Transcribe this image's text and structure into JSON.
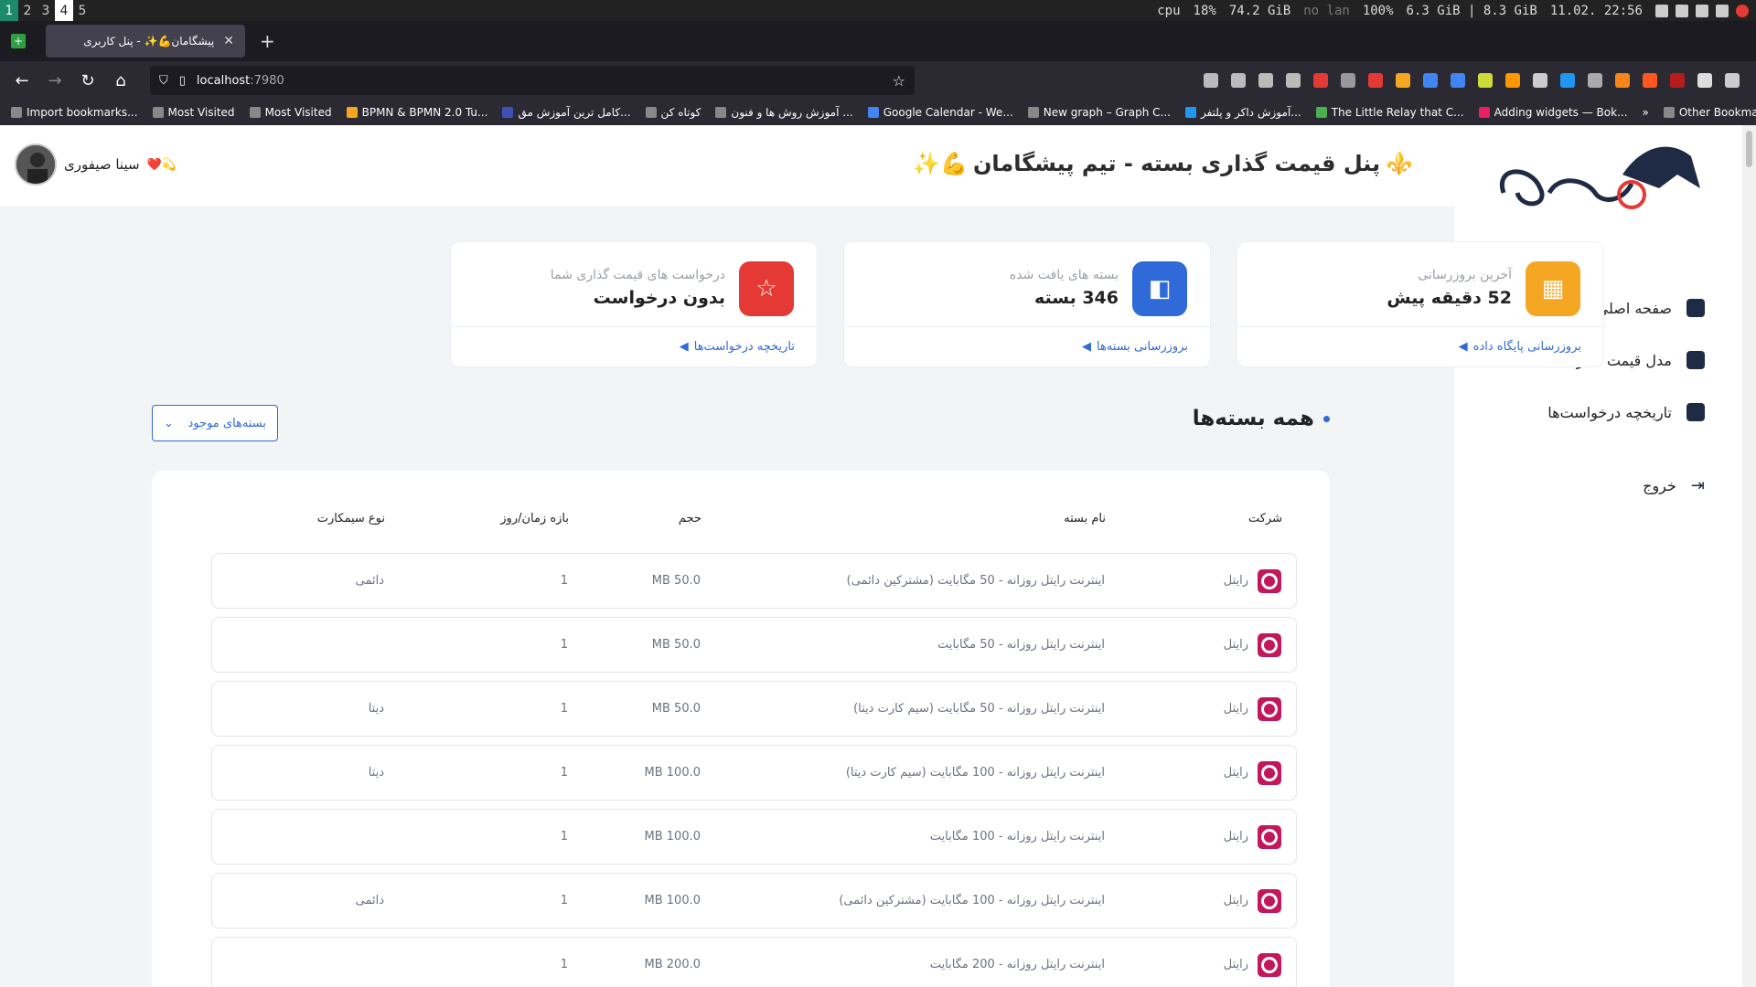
{
  "system": {
    "workspaces": [
      "1",
      "2",
      "3",
      "4",
      "5"
    ],
    "cpu_label": "cpu",
    "cpu_value": "18%",
    "disk": "74.2 GiB",
    "lan": "no lan",
    "battery": "100%",
    "memory": "6.3 GiB | 8.3 GiB",
    "datetime": "11.02. 22:56"
  },
  "browser": {
    "tab_title": "پیشگامان💪✨ - پنل کاربری",
    "url_host": "localhost",
    "url_port": ":7980",
    "bookmarks": [
      "Import bookmarks...",
      "Most Visited",
      "Most Visited",
      "BPMN & BPMN 2.0 Tu...",
      "کامل ترین آموزش مق...",
      "کوتاه کن",
      "آموزش روش ها و فنون ...",
      "Google Calendar - We...",
      "New graph – Graph C...",
      "آموزش داکر و پلتفر...",
      "The Little Relay that C...",
      "Adding widgets — Bok..."
    ],
    "other_bookmarks": "Other Bookmarks"
  },
  "header": {
    "title": "پنل قیمت گذاری بسته - تیم پیشگامان",
    "title_prefix_emoji": "⚜️",
    "title_suffix_emoji": "💪✨",
    "user_name": "سینا صیفوری",
    "user_emoji": "❤️💫"
  },
  "sidebar": {
    "items": [
      {
        "label": "صفحه اصلی پنل"
      },
      {
        "label": "مدل قیمت گذاری"
      },
      {
        "label": "تاریخچه درخواست‌ها"
      }
    ],
    "logout": "خروج"
  },
  "cards": [
    {
      "label": "آخرین بروزرسانی",
      "value": "52 دقیقه پیش",
      "link": "بروزرسانی پایگاه داده",
      "color": "#f5a623"
    },
    {
      "label": "بسته های یافت شده",
      "value": "346 بسته",
      "link": "بروزرسانی بسته‌ها",
      "color": "#2f6ad8"
    },
    {
      "label": "درخواست های قیمت گذاری شما",
      "value": "بدون درخواست",
      "link": "تاریخچه درخواست‌ها",
      "color": "#e53935"
    }
  ],
  "packages": {
    "title": "همه بسته‌ها",
    "filter": "بسته‌های موجود",
    "columns": [
      "شرکت",
      "نام بسته",
      "حجم",
      "بازه زمان/روز",
      "نوع سیمکارت"
    ],
    "rows": [
      {
        "company": "رایتل",
        "name": "اینترنت رایتل روزانه - 50 مگابایت (مشترکین دائمی)",
        "volume": "50.0 MB",
        "days": "1",
        "sim": "دائمی"
      },
      {
        "company": "رایتل",
        "name": "اینترنت رایتل روزانه - 50 مگابایت",
        "volume": "50.0 MB",
        "days": "1",
        "sim": ""
      },
      {
        "company": "رایتل",
        "name": "اینترنت رایتل روزانه - 50 مگابایت (سیم کارت دیتا)",
        "volume": "50.0 MB",
        "days": "1",
        "sim": "دیتا"
      },
      {
        "company": "رایتل",
        "name": "اینترنت رایتل روزانه - 100 مگابایت (سیم کارت دیتا)",
        "volume": "100.0 MB",
        "days": "1",
        "sim": "دیتا"
      },
      {
        "company": "رایتل",
        "name": "اینترنت رایتل روزانه - 100 مگابایت",
        "volume": "100.0 MB",
        "days": "1",
        "sim": ""
      },
      {
        "company": "رایتل",
        "name": "اینترنت رایتل روزانه - 100 مگابایت (مشترکین دائمی)",
        "volume": "100.0 MB",
        "days": "1",
        "sim": "دائمی"
      },
      {
        "company": "رایتل",
        "name": "اینترنت رایتل روزانه - 200 مگابایت",
        "volume": "200.0 MB",
        "days": "1",
        "sim": ""
      }
    ]
  },
  "colors": {
    "brand": "#c2185b",
    "accent": "#2f6ad8"
  }
}
